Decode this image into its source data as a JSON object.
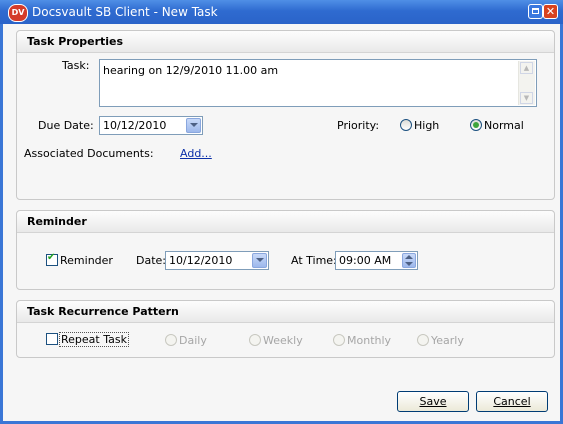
{
  "window": {
    "title": "Docsvault SB Client - New Task",
    "app_icon_text": "DV"
  },
  "task_properties": {
    "heading": "Task Properties",
    "task_label": "Task:",
    "task_value": "hearing on 12/9/2010 11.00 am",
    "due_date_label": "Due Date:",
    "due_date_value": "10/12/2010",
    "priority_label": "Priority:",
    "priority_options": [
      {
        "label": "High",
        "selected": false
      },
      {
        "label": "Normal",
        "selected": true
      }
    ],
    "associated_docs_label": "Associated Documents:",
    "add_link": "Add..."
  },
  "reminder": {
    "heading": "Reminder",
    "checkbox_label": "Reminder",
    "checked": true,
    "date_label": "Date:",
    "date_value": "10/12/2010",
    "time_label": "At Time:",
    "time_value": "09:00 AM"
  },
  "recurrence": {
    "heading": "Task Recurrence Pattern",
    "repeat_label": "Repeat Task",
    "repeat_checked": false,
    "options": [
      "Daily",
      "Weekly",
      "Monthly",
      "Yearly"
    ]
  },
  "buttons": {
    "save": "Save",
    "cancel": "Cancel"
  },
  "colors": {
    "titlebar": "#2f6bd0",
    "frame": "#3a76d6",
    "close": "#d8421f",
    "selected_radio": "#3fa43c"
  }
}
